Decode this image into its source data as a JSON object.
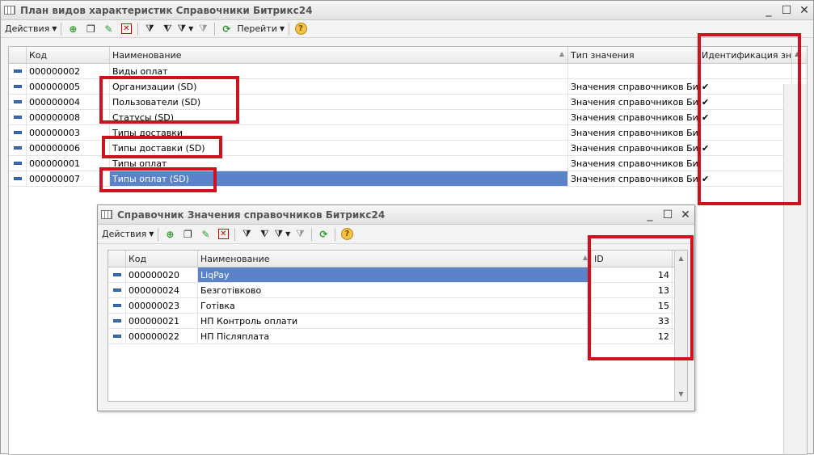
{
  "main": {
    "title": "План видов характеристик Справочники Битрикс24",
    "window_buttons": [
      "_",
      "☐",
      "✕"
    ],
    "toolbar": {
      "actions_label": "Действия",
      "goto_label": "Перейти"
    },
    "columns": [
      "Код",
      "Наименование",
      "Тип значения",
      "Идентификация зн..."
    ],
    "rows": [
      {
        "code": "000000002",
        "name": "Виды оплат",
        "type": "",
        "ident": ""
      },
      {
        "code": "000000005",
        "name": "Организации (SD)",
        "type": "Значения справочников Бит...",
        "ident": "✔"
      },
      {
        "code": "000000004",
        "name": "Пользователи (SD)",
        "type": "Значения справочников Бит...",
        "ident": "✔"
      },
      {
        "code": "000000008",
        "name": "Статусы (SD)",
        "type": "Значения справочников Бит...",
        "ident": "✔"
      },
      {
        "code": "000000003",
        "name": "Типы доставки",
        "type": "Значения справочников Бит...",
        "ident": ""
      },
      {
        "code": "000000006",
        "name": "Типы доставки (SD)",
        "type": "Значения справочников Бит...",
        "ident": "✔"
      },
      {
        "code": "000000001",
        "name": "Типы оплат",
        "type": "Значения справочников Бит...",
        "ident": ""
      },
      {
        "code": "000000007",
        "name": "Типы оплат (SD)",
        "type": "Значения справочников Бит...",
        "ident": "✔"
      }
    ]
  },
  "child": {
    "title": "Справочник Значения справочников Битрикс24",
    "window_buttons": [
      "_",
      "☐",
      "✕"
    ],
    "toolbar": {
      "actions_label": "Действия"
    },
    "columns": [
      "Код",
      "Наименование",
      "ID"
    ],
    "rows": [
      {
        "code": "000000020",
        "name": "LiqPay",
        "id": "14"
      },
      {
        "code": "000000024",
        "name": "Безготівково",
        "id": "13"
      },
      {
        "code": "000000023",
        "name": "Готівка",
        "id": "15"
      },
      {
        "code": "000000021",
        "name": "НП Контроль оплати",
        "id": "33"
      },
      {
        "code": "000000022",
        "name": "НП Післяплата",
        "id": "12"
      }
    ]
  },
  "colors": {
    "selection": "#5b83c9",
    "highlight_box": "#d0101c",
    "row_marker": "#3a6fb5"
  }
}
